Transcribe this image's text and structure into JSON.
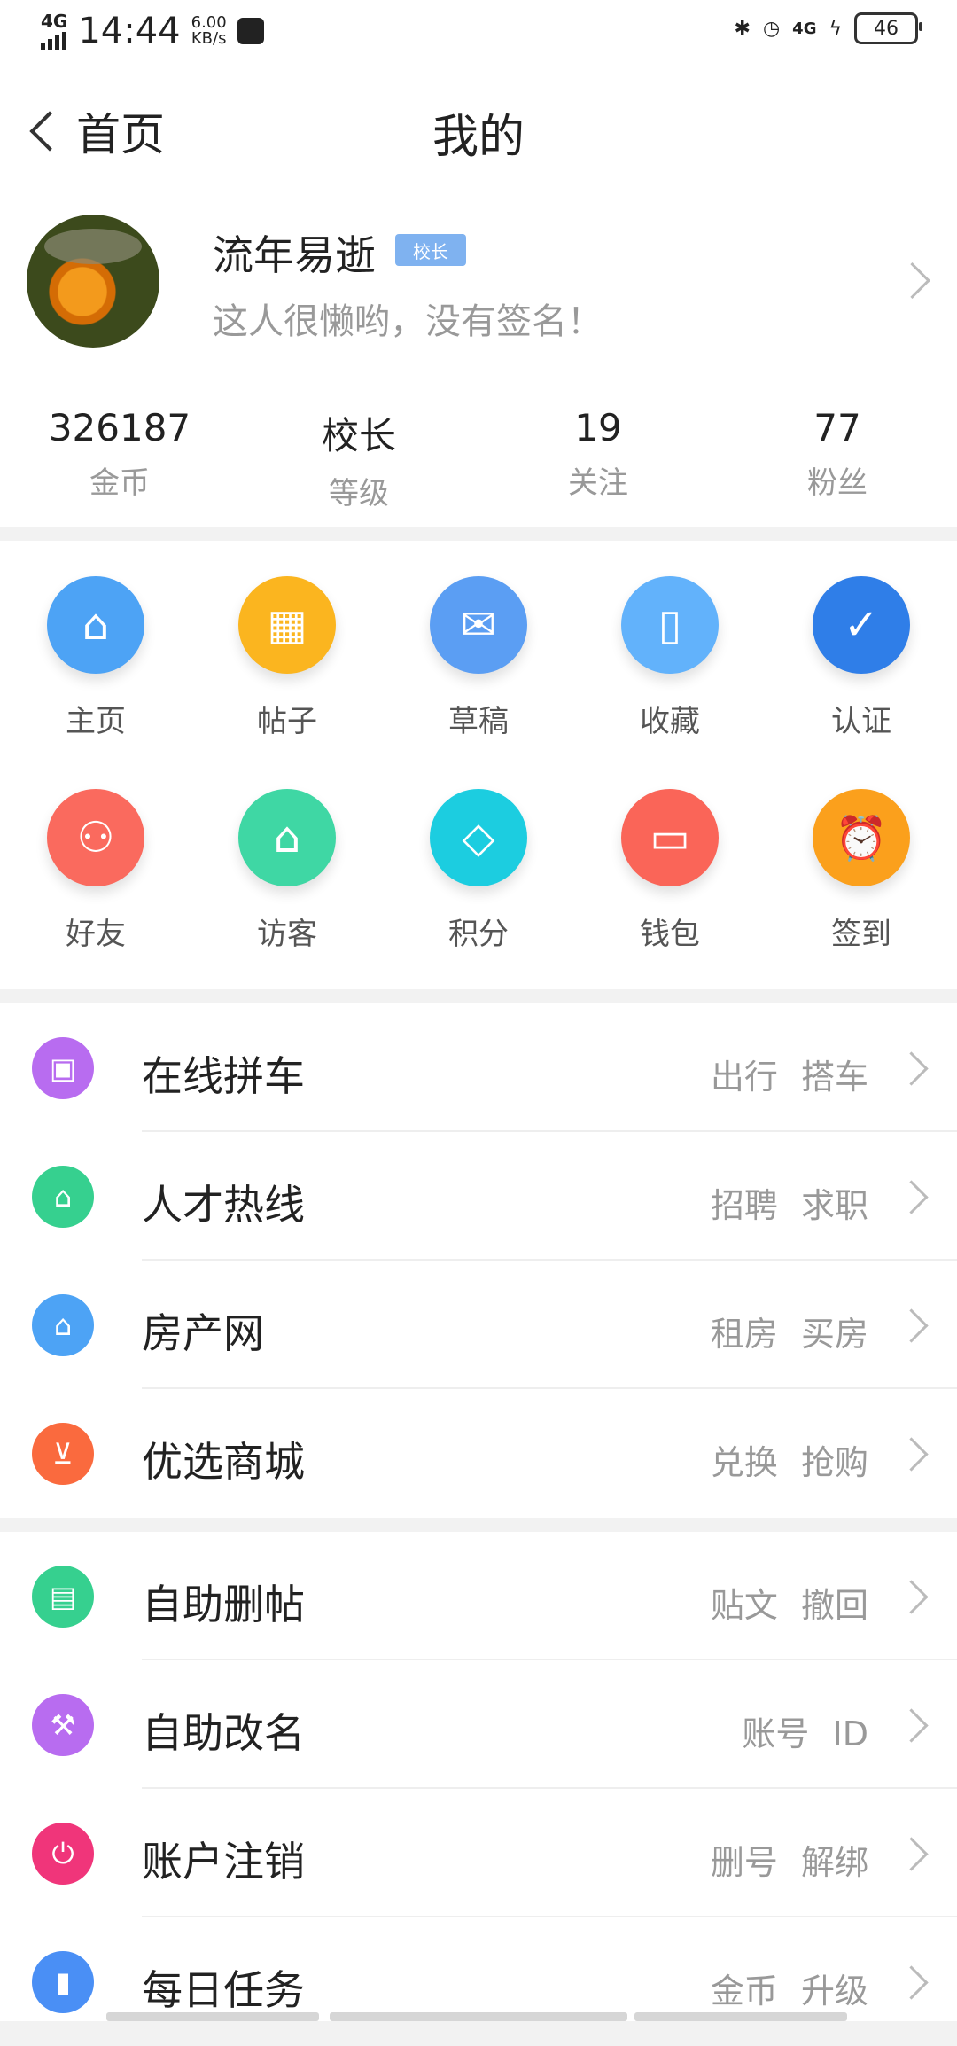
{
  "status": {
    "network": "4G",
    "time": "14:44",
    "speed": "6.00",
    "speed_unit": "KB/s",
    "net2": "4G",
    "battery": "46"
  },
  "nav": {
    "back_label": "首页",
    "title": "我的"
  },
  "profile": {
    "name": "流年易逝",
    "badge": "校长",
    "signature": "这人很懒哟，没有签名！"
  },
  "stats": [
    {
      "value": "326187",
      "label": "金币"
    },
    {
      "value": "校长",
      "label": "等级"
    },
    {
      "value": "19",
      "label": "关注"
    },
    {
      "value": "77",
      "label": "粉丝"
    }
  ],
  "grid": [
    {
      "label": "主页",
      "icon": "home-icon",
      "color": "#4da3f5"
    },
    {
      "label": "帖子",
      "icon": "calendar-icon",
      "color": "#fbb51f"
    },
    {
      "label": "草稿",
      "icon": "draft-icon",
      "color": "#5b9ef3"
    },
    {
      "label": "收藏",
      "icon": "tablet-icon",
      "color": "#62b2fb"
    },
    {
      "label": "认证",
      "icon": "shield-icon",
      "color": "#2f7ee8"
    },
    {
      "label": "好友",
      "icon": "friends-icon",
      "color": "#fa6a5e"
    },
    {
      "label": "访客",
      "icon": "graduation-cap-icon",
      "color": "#3fd7a4"
    },
    {
      "label": "积分",
      "icon": "diamond-icon",
      "color": "#1ccde0"
    },
    {
      "label": "钱包",
      "icon": "wallet-icon",
      "color": "#fa6558"
    },
    {
      "label": "签到",
      "icon": "alarm-clock-icon",
      "color": "#fba01c"
    }
  ],
  "list1": [
    {
      "title": "在线拼车",
      "sub1": "出行",
      "sub2": "搭车",
      "icon": "taxi-icon",
      "color": "#b86cf0"
    },
    {
      "title": "人才热线",
      "sub1": "招聘",
      "sub2": "求职",
      "icon": "graduation-cap-icon",
      "color": "#36d08f"
    },
    {
      "title": "房产网",
      "sub1": "租房",
      "sub2": "买房",
      "icon": "house-icon",
      "color": "#4da3f5"
    },
    {
      "title": "优选商城",
      "sub1": "兑换",
      "sub2": "抢购",
      "icon": "cart-icon",
      "color": "#fa6a3e"
    }
  ],
  "list2": [
    {
      "title": "自助删帖",
      "sub1": "贴文",
      "sub2": "撤回",
      "icon": "book-icon",
      "color": "#36d08f"
    },
    {
      "title": "自助改名",
      "sub1": "账号",
      "sub2": "ID",
      "icon": "hammer-icon",
      "color": "#b86cf0"
    },
    {
      "title": "账户注销",
      "sub1": "删号",
      "sub2": "解绑",
      "icon": "power-icon",
      "color": "#f0357a"
    },
    {
      "title": "每日任务",
      "sub1": "金币",
      "sub2": "升级",
      "icon": "bar-chart-icon",
      "color": "#4a8ff5"
    }
  ]
}
